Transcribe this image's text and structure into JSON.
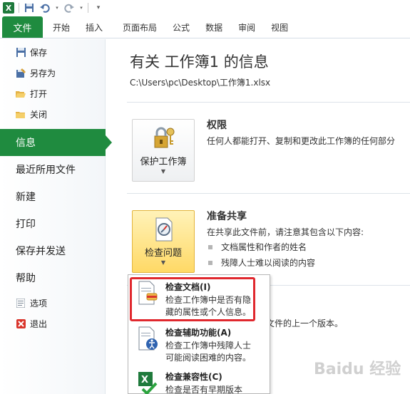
{
  "ribbon": {
    "tabs": [
      "文件",
      "开始",
      "插入",
      "页面布局",
      "公式",
      "数据",
      "审阅",
      "视图"
    ]
  },
  "nav": {
    "small_top": [
      {
        "label": "保存",
        "icon": "save-icon"
      },
      {
        "label": "另存为",
        "icon": "save-as-icon"
      },
      {
        "label": "打开",
        "icon": "open-folder-icon"
      },
      {
        "label": "关闭",
        "icon": "close-folder-icon"
      }
    ],
    "big": [
      "信息",
      "最近所用文件",
      "新建",
      "打印",
      "保存并发送",
      "帮助"
    ],
    "small_bottom": [
      {
        "label": "选项",
        "icon": "options-icon"
      },
      {
        "label": "退出",
        "icon": "exit-icon"
      }
    ]
  },
  "main": {
    "title": "有关 工作簿1 的信息",
    "path": "C:\\Users\\pc\\Desktop\\工作簿1.xlsx",
    "permissions": {
      "button_label": "保护工作簿",
      "title": "权限",
      "desc": "任何人都能打开、复制和更改此工作簿的任何部分"
    },
    "prepare": {
      "button_label": "检查问题",
      "title": "准备共享",
      "desc": "在共享此文件前，请注意其包含以下内容:",
      "bullets": [
        "文档属性和作者的姓名",
        "残障人士难以阅读的内容"
      ]
    },
    "versions": {
      "desc_partial": "文件的上一个版本。"
    }
  },
  "dropdown": {
    "items": [
      {
        "title": "检查文档(I)",
        "desc": [
          "检查工作簿中是否有隐",
          "藏的属性或个人信息。"
        ]
      },
      {
        "title": "检查辅助功能(A)",
        "desc": [
          "检查工作簿中残障人士",
          "可能阅读困难的内容。"
        ]
      },
      {
        "title": "检查兼容性(C)",
        "desc": [
          "检查是否有早期版本"
        ]
      }
    ]
  },
  "watermark": "Baidu 经验",
  "colors": {
    "file_tab": "#1f8b3f",
    "nav_active": "#1f8b3f",
    "highlight": "#e0282e"
  }
}
